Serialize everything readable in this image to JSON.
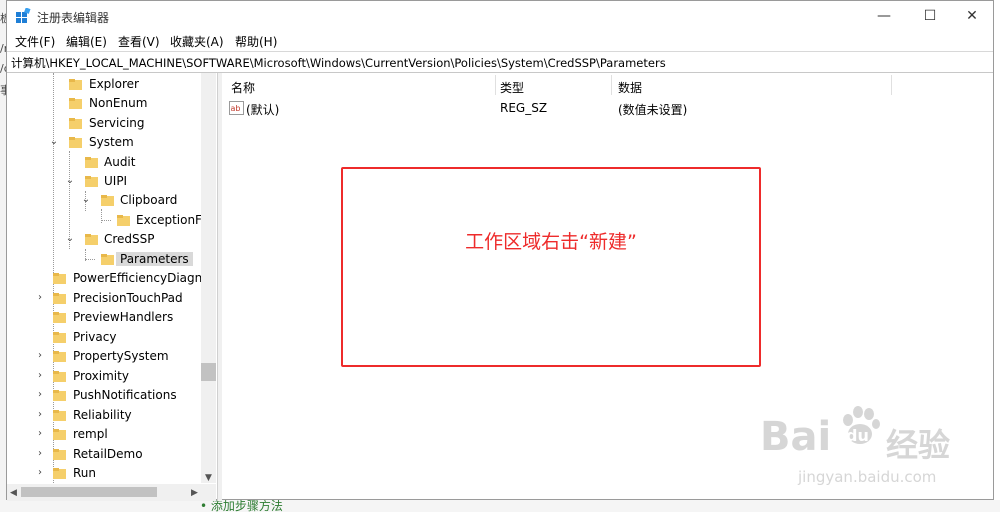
{
  "window": {
    "title": "注册表编辑器",
    "controls": {
      "minimize": "—",
      "maximize": "☐",
      "close": "✕"
    }
  },
  "menu": [
    "文件(F)",
    "编辑(E)",
    "查看(V)",
    "收藏夹(A)",
    "帮助(H)"
  ],
  "address": "计算机\\HKEY_LOCAL_MACHINE\\SOFTWARE\\Microsoft\\Windows\\CurrentVersion\\Policies\\System\\CredSSP\\Parameters",
  "tree": {
    "items": [
      {
        "label": "Explorer"
      },
      {
        "label": "NonEnum"
      },
      {
        "label": "Servicing"
      },
      {
        "label": "System"
      },
      {
        "label": "Audit"
      },
      {
        "label": "UIPI"
      },
      {
        "label": "Clipboard"
      },
      {
        "label": "ExceptionFor"
      },
      {
        "label": "CredSSP"
      },
      {
        "label": "Parameters"
      },
      {
        "label": "PowerEfficiencyDiagnos"
      },
      {
        "label": "PrecisionTouchPad"
      },
      {
        "label": "PreviewHandlers"
      },
      {
        "label": "Privacy"
      },
      {
        "label": "PropertySystem"
      },
      {
        "label": "Proximity"
      },
      {
        "label": "PushNotifications"
      },
      {
        "label": "Reliability"
      },
      {
        "label": "rempl"
      },
      {
        "label": "RetailDemo"
      },
      {
        "label": "Run"
      }
    ]
  },
  "list": {
    "columns": [
      "名称",
      "类型",
      "数据"
    ],
    "rows": [
      {
        "name": "(默认)",
        "type": "REG_SZ",
        "data": "(数值未设置)"
      }
    ]
  },
  "annotation": {
    "text": "工作区域右击“新建”",
    "color": "#ee2b2b"
  },
  "watermark": {
    "brand_left": "Bai",
    "brand_right": "du",
    "brand_cn": "经验",
    "url": "jingyan.baidu.com"
  },
  "background": {
    "side_chars": [
      "板",
      "/r",
      "/d",
      "事"
    ],
    "bottom_text": "• 添加步骤方法"
  },
  "colors": {
    "accent": "#ee2b2b",
    "folder": "#f5cf6b",
    "selected": "#d9d9d9"
  },
  "icons": {
    "app": "regedit-icon",
    "folder": "folder-icon",
    "value": "reg-string-icon"
  }
}
